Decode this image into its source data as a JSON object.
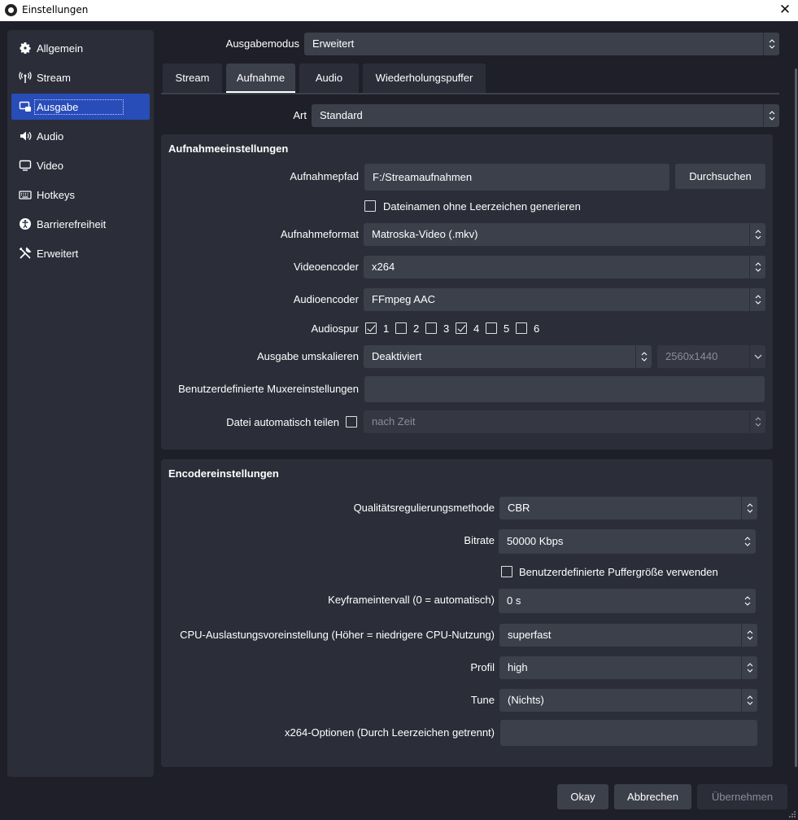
{
  "window": {
    "title": "Einstellungen",
    "close_glyph": "✕"
  },
  "sidebar": {
    "items": [
      {
        "label": "Allgemein",
        "icon": "gear-icon"
      },
      {
        "label": "Stream",
        "icon": "antenna-icon"
      },
      {
        "label": "Ausgabe",
        "icon": "output-icon",
        "active": true
      },
      {
        "label": "Audio",
        "icon": "speaker-icon"
      },
      {
        "label": "Video",
        "icon": "monitor-icon"
      },
      {
        "label": "Hotkeys",
        "icon": "keyboard-icon"
      },
      {
        "label": "Barrierefreiheit",
        "icon": "accessibility-icon"
      },
      {
        "label": "Erweitert",
        "icon": "tools-icon"
      }
    ]
  },
  "output_mode": {
    "label": "Ausgabemodus",
    "value": "Erweitert"
  },
  "tabs": [
    {
      "label": "Stream"
    },
    {
      "label": "Aufnahme",
      "active": true
    },
    {
      "label": "Audio"
    },
    {
      "label": "Wiederholungspuffer"
    }
  ],
  "type": {
    "label": "Art",
    "value": "Standard"
  },
  "recording": {
    "title": "Aufnahmeeinstellungen",
    "path_label": "Aufnahmepfad",
    "path_value": "F:/Streamaufnahmen",
    "browse_label": "Durchsuchen",
    "no_spaces_label": "Dateinamen ohne Leerzeichen generieren",
    "format_label": "Aufnahmeformat",
    "format_value": "Matroska-Video (.mkv)",
    "video_encoder_label": "Videoencoder",
    "video_encoder_value": "x264",
    "audio_encoder_label": "Audioencoder",
    "audio_encoder_value": "FFmpeg AAC",
    "audio_track_label": "Audiospur",
    "tracks": [
      {
        "label": "1",
        "checked": true
      },
      {
        "label": "2",
        "checked": false
      },
      {
        "label": "3",
        "checked": false
      },
      {
        "label": "4",
        "checked": true
      },
      {
        "label": "5",
        "checked": false
      },
      {
        "label": "6",
        "checked": false
      }
    ],
    "rescale_label": "Ausgabe umskalieren",
    "rescale_value": "Deaktiviert",
    "rescale_resolution": "2560x1440",
    "muxer_label": "Benutzerdefinierte Muxereinstellungen",
    "muxer_value": "",
    "split_label": "Datei automatisch teilen",
    "split_value": "nach Zeit"
  },
  "encoder": {
    "title": "Encodereinstellungen",
    "rate_control_label": "Qualitätsregulierungsmethode",
    "rate_control_value": "CBR",
    "bitrate_label": "Bitrate",
    "bitrate_value": "50000 Kbps",
    "custom_buffer_label": "Benutzerdefinierte Puffergröße verwenden",
    "keyframe_label": "Keyframeintervall (0 = automatisch)",
    "keyframe_value": "0 s",
    "cpu_preset_label": "CPU-Auslastungsvoreinstellung (Höher = niedrigere CPU-Nutzung)",
    "cpu_preset_value": "superfast",
    "profile_label": "Profil",
    "profile_value": "high",
    "tune_label": "Tune",
    "tune_value": "(Nichts)",
    "options_label": "x264-Optionen (Durch Leerzeichen getrennt)",
    "options_value": ""
  },
  "footer": {
    "ok_label": "Okay",
    "cancel_label": "Abbrechen",
    "apply_label": "Übernehmen"
  },
  "colors": {
    "accent": "#284cb8",
    "panel": "#2b2e38",
    "field": "#3c404b",
    "background": "#1e1f29"
  }
}
